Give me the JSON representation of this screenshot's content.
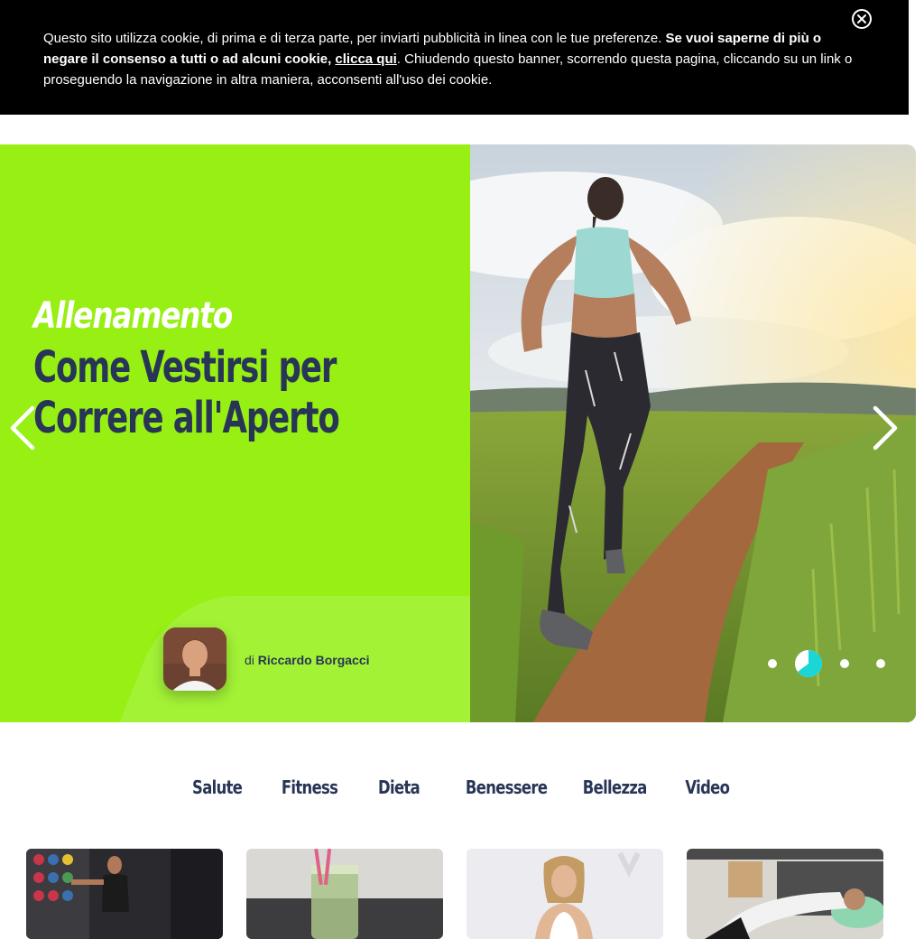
{
  "cookie_banner": {
    "text_1": "Questo sito utilizza cookie, di prima e di terza parte, per inviarti pubblicità in linea con le tue preferenze. ",
    "text_bold": "Se vuoi saperne di più o negare il consenso a tutti o ad alcuni cookie, ",
    "link_label": "clicca qui",
    "text_2": ". Chiudendo questo banner, scorrendo questa pagina, cliccando su un link o proseguendo la navigazione in altra maniera, acconsenti all'uso dei cookie.",
    "close_icon": "close-icon"
  },
  "hero": {
    "category": "Allenamento",
    "title_line_1": "Come Vestirsi per",
    "title_line_2": "Correre all'Aperto",
    "author_prefix": "di",
    "author_name": "Riccardo Borgacci",
    "prev_icon": "chevron-left-icon",
    "next_icon": "chevron-right-icon",
    "slide_count": 4,
    "active_slide": 2,
    "accent_color": "#97ef13",
    "active_dot_color": "#1ad6d6",
    "title_color": "#283556"
  },
  "categories": [
    "Salute",
    "Fitness",
    "Dieta",
    "Benessere",
    "Bellezza",
    "Video"
  ]
}
